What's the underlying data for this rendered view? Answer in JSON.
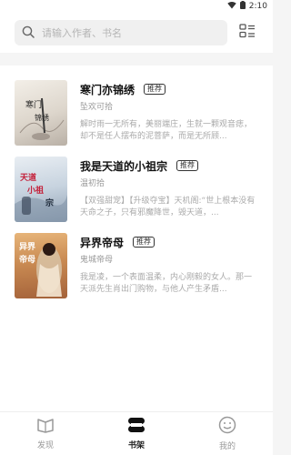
{
  "status": {
    "time": "2:10",
    "wifi_icon": "wifi-icon",
    "battery_icon": "battery-icon"
  },
  "search": {
    "placeholder": "请输入作者、书名"
  },
  "books": [
    {
      "title": "寒门亦锦绣",
      "badge": "推荐",
      "author": "坠欢可拾",
      "desc": "解时雨一无所有，美丽端庄，生就一颗观音痣，却不是任人摆布的泥菩萨，而是无所顾...",
      "cover_text": "寒门亦锦绣"
    },
    {
      "title": "我是天道的小祖宗",
      "badge": "推荐",
      "author": "温初拾",
      "desc": "【双强甜宠】【升级夺宝】天机阁:“世上根本没有天命之子，只有邪魔降世，毁天道，...",
      "cover_text": "天道小祖宗"
    },
    {
      "title": "异界帝母",
      "badge": "推荐",
      "author": "鬼城帝母",
      "desc": "我是凌，一个表面温柔，内心刚毅的女人。那一天派先生肖出门购物，与他人产生矛盾...",
      "cover_text": "异界帝母"
    }
  ],
  "nav": [
    {
      "label": "发现",
      "icon": "book-open-icon"
    },
    {
      "label": "书架",
      "icon": "bookshelf-icon"
    },
    {
      "label": "我的",
      "icon": "smiley-face-icon"
    }
  ]
}
